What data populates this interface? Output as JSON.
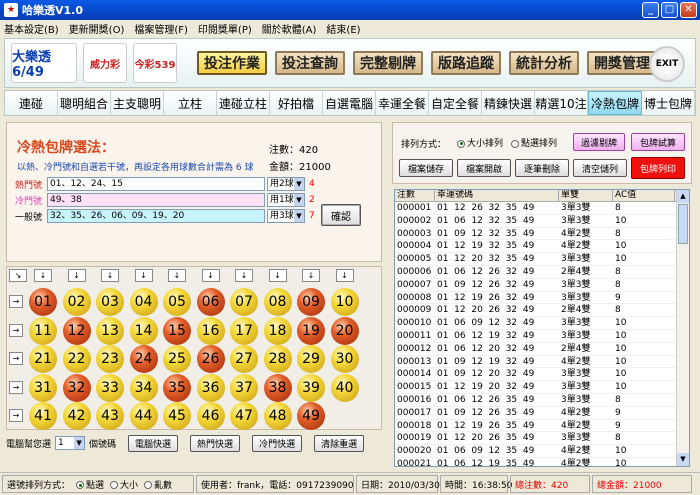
{
  "window": {
    "title": "哈樂透V1.0"
  },
  "menu": [
    "基本設定(B)",
    "更新開獎(O)",
    "檔案管理(F)",
    "印閱獎單(P)",
    "關於軟體(A)",
    "結束(E)"
  ],
  "logos": [
    "大樂透 6/49",
    "威力彩",
    "今彩539"
  ],
  "main_buttons": [
    "投注作業",
    "投注查詢",
    "完整剔牌",
    "版路追蹤",
    "統計分析",
    "開獎管理"
  ],
  "exit_label": "EXIT",
  "tabs": [
    "連碰",
    "聰明組合",
    "主支聰明",
    "立柱",
    "連碰立柱",
    "好拍檔",
    "自選電腦",
    "幸運全餐",
    "自定全餐",
    "精鍊快選",
    "精選10注",
    "冷熱包牌",
    "博士包牌"
  ],
  "active_tab": "冷熱包牌",
  "panel": {
    "title": "冷熱包牌選法：",
    "desc": "以熱、冷門號和自選若干號，再設定各用球數合計需為 6 球",
    "count_label": "注數：420",
    "amount_label": "金額：21000",
    "hot": {
      "label": "熱門號",
      "value": "01、12、24、15",
      "use": "用2球",
      "count": "4"
    },
    "cold": {
      "label": "冷門號",
      "value": "49、38",
      "use": "用1球",
      "count": "2"
    },
    "normal": {
      "label": "一般號",
      "value": "32、35、26、06、09、19、20",
      "use": "用3球",
      "count": "7"
    },
    "confirm_label": "確認"
  },
  "balls": [
    {
      "n": "01",
      "c": "r"
    },
    {
      "n": "02",
      "c": "y"
    },
    {
      "n": "03",
      "c": "y"
    },
    {
      "n": "04",
      "c": "y"
    },
    {
      "n": "05",
      "c": "y"
    },
    {
      "n": "06",
      "c": "r"
    },
    {
      "n": "07",
      "c": "y"
    },
    {
      "n": "08",
      "c": "y"
    },
    {
      "n": "09",
      "c": "r"
    },
    {
      "n": "10",
      "c": "y"
    },
    {
      "n": "11",
      "c": "y"
    },
    {
      "n": "12",
      "c": "r"
    },
    {
      "n": "13",
      "c": "y"
    },
    {
      "n": "14",
      "c": "y"
    },
    {
      "n": "15",
      "c": "r"
    },
    {
      "n": "16",
      "c": "y"
    },
    {
      "n": "17",
      "c": "y"
    },
    {
      "n": "18",
      "c": "y"
    },
    {
      "n": "19",
      "c": "r"
    },
    {
      "n": "20",
      "c": "r"
    },
    {
      "n": "21",
      "c": "y"
    },
    {
      "n": "22",
      "c": "y"
    },
    {
      "n": "23",
      "c": "y"
    },
    {
      "n": "24",
      "c": "r"
    },
    {
      "n": "25",
      "c": "y"
    },
    {
      "n": "26",
      "c": "r"
    },
    {
      "n": "27",
      "c": "y"
    },
    {
      "n": "28",
      "c": "y"
    },
    {
      "n": "29",
      "c": "y"
    },
    {
      "n": "30",
      "c": "y"
    },
    {
      "n": "31",
      "c": "y"
    },
    {
      "n": "32",
      "c": "r"
    },
    {
      "n": "33",
      "c": "y"
    },
    {
      "n": "34",
      "c": "y"
    },
    {
      "n": "35",
      "c": "r"
    },
    {
      "n": "36",
      "c": "y"
    },
    {
      "n": "37",
      "c": "y"
    },
    {
      "n": "38",
      "c": "r"
    },
    {
      "n": "39",
      "c": "y"
    },
    {
      "n": "40",
      "c": "y"
    },
    {
      "n": "41",
      "c": "y"
    },
    {
      "n": "42",
      "c": "y"
    },
    {
      "n": "43",
      "c": "y"
    },
    {
      "n": "44",
      "c": "y"
    },
    {
      "n": "45",
      "c": "y"
    },
    {
      "n": "46",
      "c": "y"
    },
    {
      "n": "47",
      "c": "y"
    },
    {
      "n": "48",
      "c": "y"
    },
    {
      "n": "49",
      "c": "r"
    }
  ],
  "ball_controls": {
    "computer_label": "電腦幫您選",
    "computer_value": "1",
    "unit": "個號碼",
    "buttons": [
      "電腦快選",
      "熱門快選",
      "冷門快選",
      "清除重選"
    ]
  },
  "sort": {
    "label": "排列方式：",
    "options": [
      "大小排列",
      "點選排列"
    ],
    "selected": "大小排列"
  },
  "right_buttons": [
    "檔案儲存",
    "檔案開啟",
    "逐筆刪除",
    "清空儲列",
    "過濾剔牌",
    "包牌試算",
    "包牌列印"
  ],
  "table": {
    "headers": [
      "注數",
      "幸運號碼",
      "單雙",
      "AC值"
    ],
    "rows": [
      [
        "000001",
        "01  12  26  32  35  49",
        "3單3雙",
        "8"
      ],
      [
        "000002",
        "01  06  12  32  35  49",
        "3單3雙",
        "10"
      ],
      [
        "000003",
        "01  09  12  32  35  49",
        "4單2雙",
        "8"
      ],
      [
        "000004",
        "01  12  19  32  35  49",
        "4單2雙",
        "10"
      ],
      [
        "000005",
        "01  12  20  32  35  49",
        "3單3雙",
        "10"
      ],
      [
        "000006",
        "01  06  12  26  32  49",
        "2單4雙",
        "8"
      ],
      [
        "000007",
        "01  09  12  26  32  49",
        "3單3雙",
        "8"
      ],
      [
        "000008",
        "01  12  19  26  32  49",
        "3單3雙",
        "9"
      ],
      [
        "000009",
        "01  12  20  26  32  49",
        "2單4雙",
        "8"
      ],
      [
        "000010",
        "01  06  09  12  32  49",
        "3單3雙",
        "10"
      ],
      [
        "000011",
        "01  06  12  19  32  49",
        "3單3雙",
        "10"
      ],
      [
        "000012",
        "01  06  12  20  32  49",
        "2單4雙",
        "10"
      ],
      [
        "000013",
        "01  09  12  19  32  49",
        "4單2雙",
        "10"
      ],
      [
        "000014",
        "01  09  12  20  32  49",
        "3單3雙",
        "10"
      ],
      [
        "000015",
        "01  12  19  20  32  49",
        "3單3雙",
        "10"
      ],
      [
        "000016",
        "01  06  12  26  35  49",
        "3單3雙",
        "8"
      ],
      [
        "000017",
        "01  09  12  26  35  49",
        "4單2雙",
        "9"
      ],
      [
        "000018",
        "01  12  19  26  35  49",
        "4單2雙",
        "9"
      ],
      [
        "000019",
        "01  12  20  26  35  49",
        "3單3雙",
        "8"
      ],
      [
        "000020",
        "01  06  09  12  35  49",
        "4單2雙",
        "10"
      ],
      [
        "000021",
        "01  06  12  19  35  49",
        "4單2雙",
        "10"
      ]
    ]
  },
  "status": {
    "pick_label": "選號排列方式：",
    "pick_options": [
      "點選",
      "大小",
      "亂數"
    ],
    "pick_selected": "點選",
    "user": "使用者：frank，電話：0917239090",
    "date": "日期：2010/03/30",
    "time": "時間：16:38:50",
    "total_count": "總注數：420",
    "total_amount": "總金額：21000"
  }
}
